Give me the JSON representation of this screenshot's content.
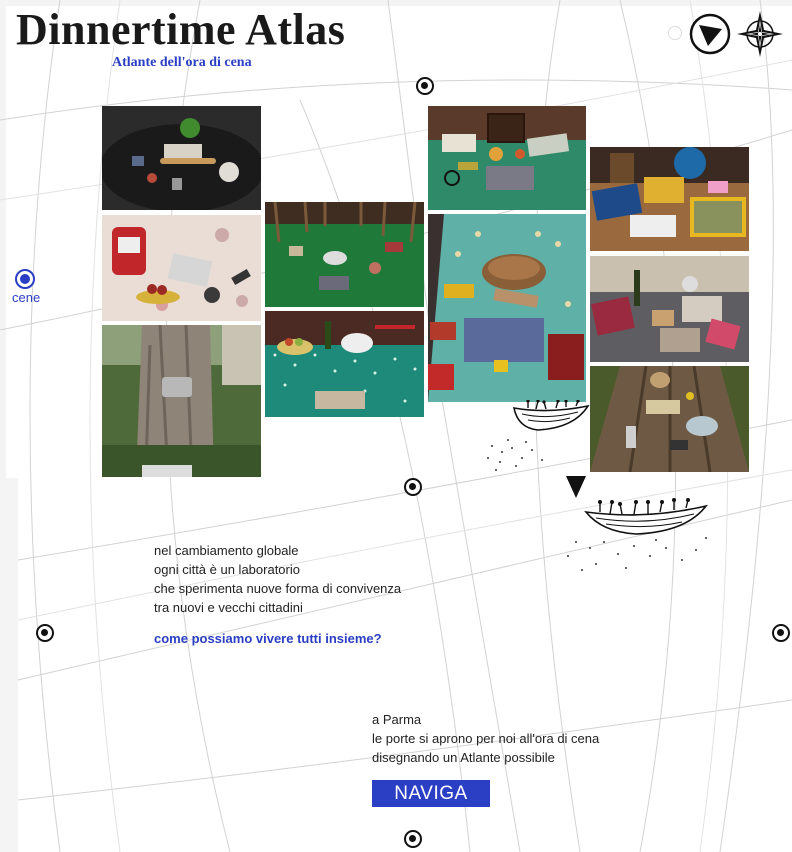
{
  "header": {
    "title": "Dinnertime Atlas",
    "subtitle": "Atlante dell'ora di cena"
  },
  "nav": {
    "side_label": "cene"
  },
  "photos": [
    {
      "name": "dinner-table-black"
    },
    {
      "name": "dinner-table-floral"
    },
    {
      "name": "tree-trunk"
    },
    {
      "name": "dinner-table-green-floor"
    },
    {
      "name": "dinner-table-teal-polka"
    },
    {
      "name": "dinner-table-green-chair"
    },
    {
      "name": "dinner-table-teal-bread"
    },
    {
      "name": "dinner-table-wood-fabric"
    },
    {
      "name": "dinner-table-gray-kitchen"
    },
    {
      "name": "dinner-table-outdoor-wood"
    }
  ],
  "intro": {
    "lines": [
      "nel cambiamento globale",
      "ogni città è un laboratorio",
      "che sperimenta nuove forma di convivenza",
      "tra nuovi e vecchi cittadini"
    ],
    "question": "come possiamo vivere tutti insieme?"
  },
  "parma": {
    "lines": [
      "a Parma",
      "le porte si aprono per noi all'ora di cena",
      "disegnando un Atlante possibile"
    ],
    "button_label": "NAVIGA"
  },
  "colors": {
    "accent": "#2a3fc4",
    "text": "#222222",
    "map_lines": "#cfcfcf"
  },
  "icons": {
    "top_left": "navigation-arrow-icon",
    "top_right": "compass-rose-icon"
  }
}
